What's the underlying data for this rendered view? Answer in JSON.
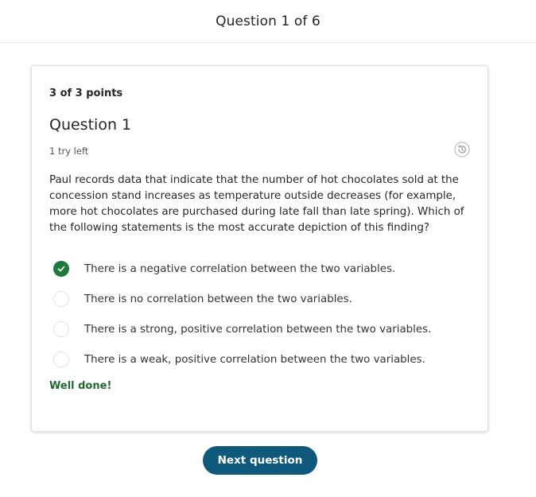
{
  "header": {
    "title": "Question 1 of 6"
  },
  "card": {
    "points": "3 of 3 points",
    "question_title": "Question 1",
    "tries": "1 try left",
    "history_icon": "history-icon",
    "prompt": "Paul records data that indicate that the number of hot chocolates sold at the concession stand increases as temperature outside decreases (for example, more hot chocolates are purchased during late fall than late spring). Which of the following statements is the most accurate depiction of this finding?",
    "options": [
      {
        "label": "There is a negative correlation between the two variables.",
        "state": "correct-selected"
      },
      {
        "label": "There is no correlation between the two variables.",
        "state": "unselected"
      },
      {
        "label": "There is a strong, positive correlation between the two variables.",
        "state": "unselected"
      },
      {
        "label": "There is a weak, positive correlation between the two variables.",
        "state": "unselected"
      }
    ],
    "feedback": "Well done!"
  },
  "actions": {
    "next_label": "Next question"
  },
  "colors": {
    "correct": "#1e7a3c",
    "feedback_text": "#1e6b31",
    "primary_button": "#0f5a7c"
  }
}
